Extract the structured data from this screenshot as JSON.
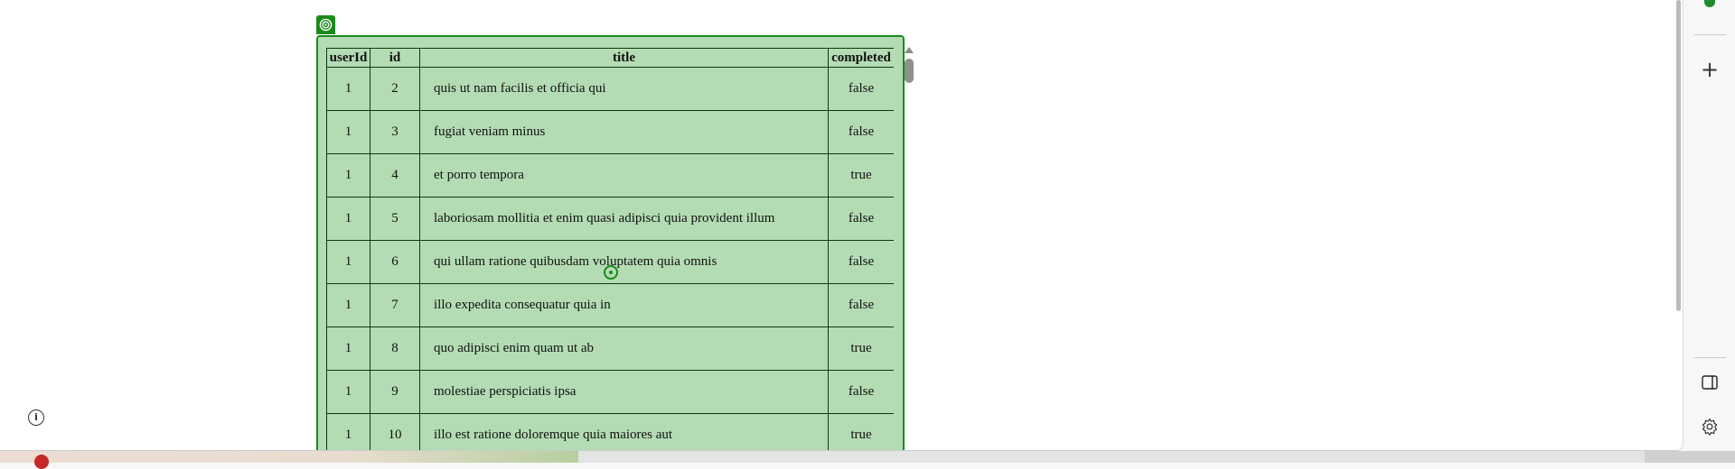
{
  "table": {
    "headers": [
      "userId",
      "id",
      "title",
      "completed"
    ],
    "rows": [
      [
        "1",
        "2",
        "quis ut nam facilis et officia qui",
        "false"
      ],
      [
        "1",
        "3",
        "fugiat veniam minus",
        "false"
      ],
      [
        "1",
        "4",
        "et porro tempora",
        "true"
      ],
      [
        "1",
        "5",
        "laboriosam mollitia et enim quasi adipisci quia provident illum",
        "false"
      ],
      [
        "1",
        "6",
        "qui ullam ratione quibusdam voluptatem quia omnis",
        "false"
      ],
      [
        "1",
        "7",
        "illo expedita consequatur quia in",
        "false"
      ],
      [
        "1",
        "8",
        "quo adipisci enim quam ut ab",
        "true"
      ],
      [
        "1",
        "9",
        "molestiae perspiciatis ipsa",
        "false"
      ],
      [
        "1",
        "10",
        "illo est ratione doloremque quia maiores aut",
        "true"
      ]
    ]
  },
  "icons": {
    "highlight_badge": "target-icon",
    "info": "info-icon",
    "sidebar": [
      "add-icon",
      "split-view-icon",
      "gear-icon"
    ]
  },
  "sidebar": {
    "add_symbol": "+",
    "info_symbol": "i"
  },
  "colors": {
    "highlight": "#1a8a1a",
    "highlight_fill": "#b4dcb4"
  }
}
